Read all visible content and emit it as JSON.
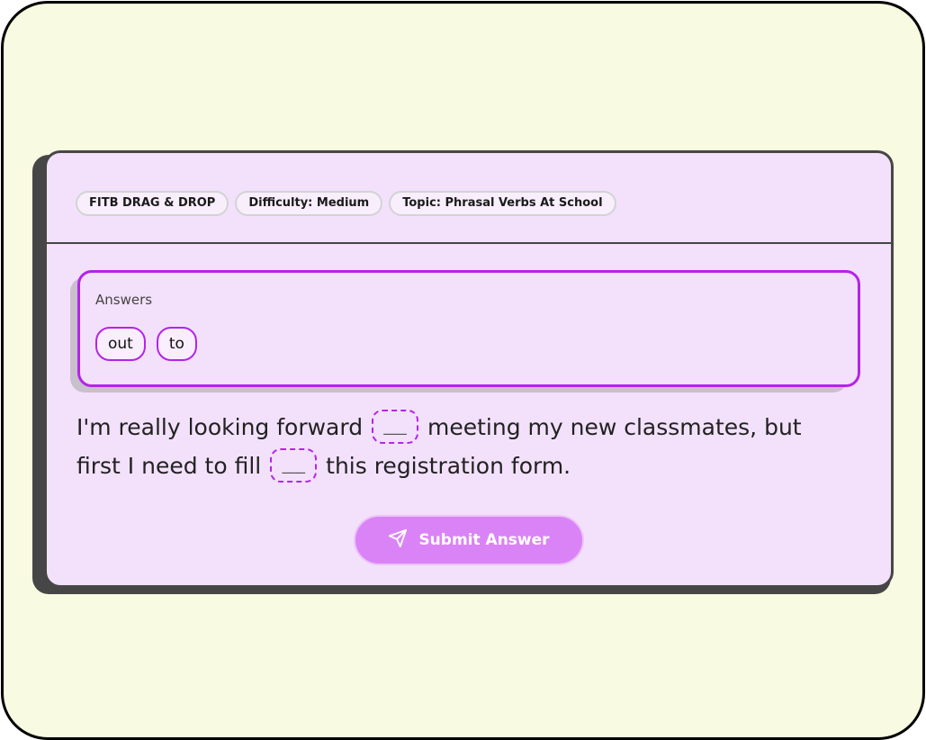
{
  "tags": [
    {
      "label": "FITB DRAG & DROP"
    },
    {
      "label": "Difficulty: Medium"
    },
    {
      "label": "Topic: Phrasal Verbs At School"
    }
  ],
  "answers": {
    "label": "Answers",
    "chips": [
      "out",
      "to"
    ]
  },
  "sentence": {
    "part1": "I'm really looking forward",
    "part2": "meeting my new classmates, but first I need to fill",
    "part3": "this registration form.",
    "blank_placeholder": "___"
  },
  "submit": {
    "label": "Submit Answer",
    "icon": "send-icon"
  },
  "colors": {
    "background": "#f8fae1",
    "card": "#f3e1fb",
    "accent": "#b424e8",
    "button": "#da83f6"
  }
}
